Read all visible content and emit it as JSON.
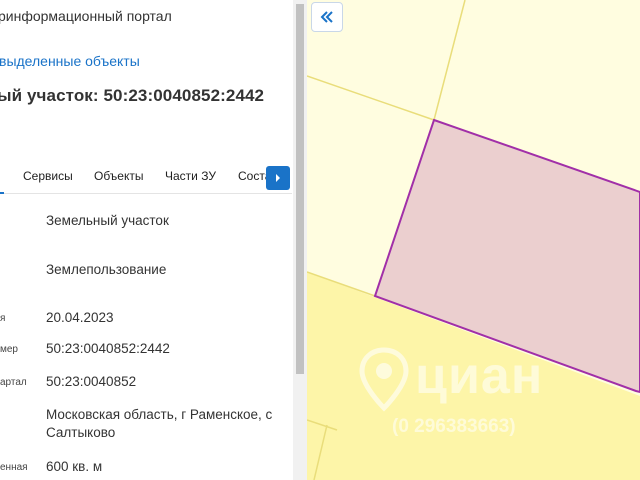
{
  "panel": {
    "portal_title": "ринформационный портал",
    "selected_objects_link": "выделенные объекты",
    "parcel_title": "ый участок: 50:23:0040852:2442"
  },
  "tabs": [
    {
      "label": "Сервисы"
    },
    {
      "label": "Объекты"
    },
    {
      "label": "Части ЗУ"
    },
    {
      "label": "Соста"
    }
  ],
  "tab_next_icon": "chevron-right-icon",
  "rows": [
    {
      "label": "",
      "value": "Земельный участок"
    },
    {
      "label": "",
      "value": "Землепользование"
    },
    {
      "label": "я",
      "value": "20.04.2023"
    },
    {
      "label": "мер",
      "value": "50:23:0040852:2442"
    },
    {
      "label": "артал",
      "value": "50:23:0040852"
    },
    {
      "label": "",
      "value": "Московская область, г Раменское, с Салтыково"
    },
    {
      "label": "енная",
      "value": "600 кв. м"
    }
  ],
  "map": {
    "collapse_icon": "double-chevron-left-icon",
    "watermark_word": "циан",
    "watermark_id": "(0 296383663)",
    "colors": {
      "land_light": "#fffde0",
      "land_yellow": "#fdf5a8",
      "boundary": "#e9dd7a",
      "parcel_fill": "#ebcfcf",
      "parcel_stroke": "#a12fa8",
      "accent": "#1a73c8"
    }
  }
}
